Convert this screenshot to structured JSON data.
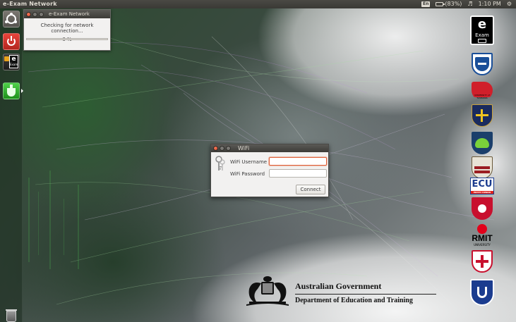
{
  "top_panel": {
    "title": "e-Exam Network",
    "keyboard": "En",
    "battery_label": "(83%)",
    "battery_level": 0.83,
    "time": "1:10 PM"
  },
  "launcher": {
    "items": [
      {
        "name": "ubuntu-dash",
        "icon": "ubuntu-logo-icon"
      },
      {
        "name": "shutdown",
        "icon": "power-icon"
      },
      {
        "name": "e-exam",
        "icon": "exam-icon"
      },
      {
        "name": "active-app",
        "icon": "flask-icon"
      },
      {
        "name": "trash",
        "icon": "trash-icon"
      }
    ]
  },
  "progress_window": {
    "title": "e-Exam Network",
    "message": "Checking for network connection...",
    "percent_label": "0 %",
    "progress": 0
  },
  "wifi_dialog": {
    "title": "WiFi",
    "username_label": "WiFi Username",
    "username_value": "",
    "password_label": "WiFi Password",
    "password_value": "",
    "connect_label": "Connect"
  },
  "logos": {
    "exam_logo_letter": "e",
    "exam_logo_word": "Exam",
    "tasmania_text": "UNIVERSITY of TASMANIA",
    "ecu_text": "ECU",
    "ecu_subtext": "EDITH COWAN",
    "rmit_text": "RMIT",
    "rmit_subtext": "UNIVERSITY"
  },
  "government": {
    "line1": "Australian Government",
    "line2": "Department of Education and Training"
  },
  "colors": {
    "panel": "#3c3b37",
    "accent": "#e05b2b",
    "dialog_bg": "#f2f1f0"
  }
}
